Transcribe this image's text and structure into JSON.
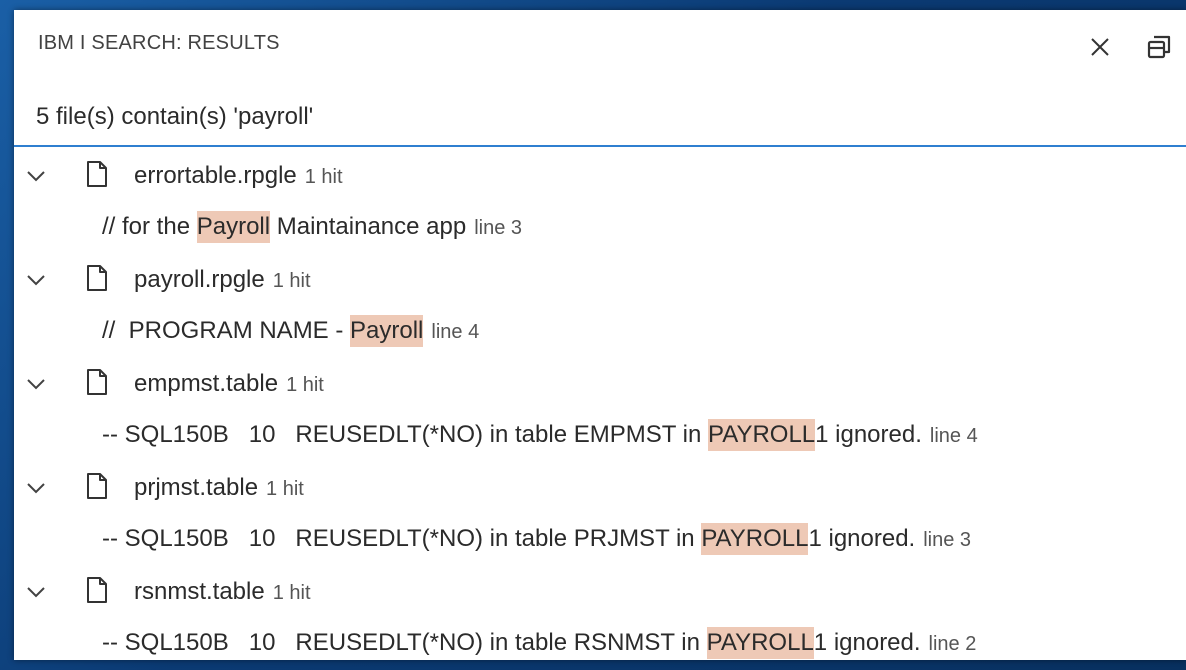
{
  "panel": {
    "title": "IBM I SEARCH: RESULTS",
    "summary": "5 file(s) contain(s) 'payroll'"
  },
  "colors": {
    "highlight": "#eec9b6",
    "divider": "#2f7fd0",
    "background": "#0e3a6b"
  },
  "results": [
    {
      "file": "errortable.rpgle",
      "hits": "1 hit",
      "match": {
        "before": "// for the ",
        "hit": "Payroll",
        "after": " Maintainance app",
        "line": "line 3"
      }
    },
    {
      "file": "payroll.rpgle",
      "hits": "1 hit",
      "match": {
        "before": "//  PROGRAM NAME - ",
        "hit": "Payroll",
        "after": "",
        "line": "line 4"
      }
    },
    {
      "file": "empmst.table",
      "hits": "1 hit",
      "match": {
        "before": "-- SQL150B   10   REUSEDLT(*NO) in table EMPMST in ",
        "hit": "PAYROLL",
        "after": "1 ignored.",
        "line": "line 4"
      }
    },
    {
      "file": "prjmst.table",
      "hits": "1 hit",
      "match": {
        "before": "-- SQL150B   10   REUSEDLT(*NO) in table PRJMST in ",
        "hit": "PAYROLL",
        "after": "1 ignored.",
        "line": "line 3"
      }
    },
    {
      "file": "rsnmst.table",
      "hits": "1 hit",
      "match": {
        "before": "-- SQL150B   10   REUSEDLT(*NO) in table RSNMST in ",
        "hit": "PAYROLL",
        "after": "1 ignored.",
        "line": "line 2"
      }
    }
  ],
  "icons": {
    "close": "close-icon",
    "restore": "restore-window-icon",
    "expand": "chevron-down-icon",
    "file": "file-icon"
  }
}
